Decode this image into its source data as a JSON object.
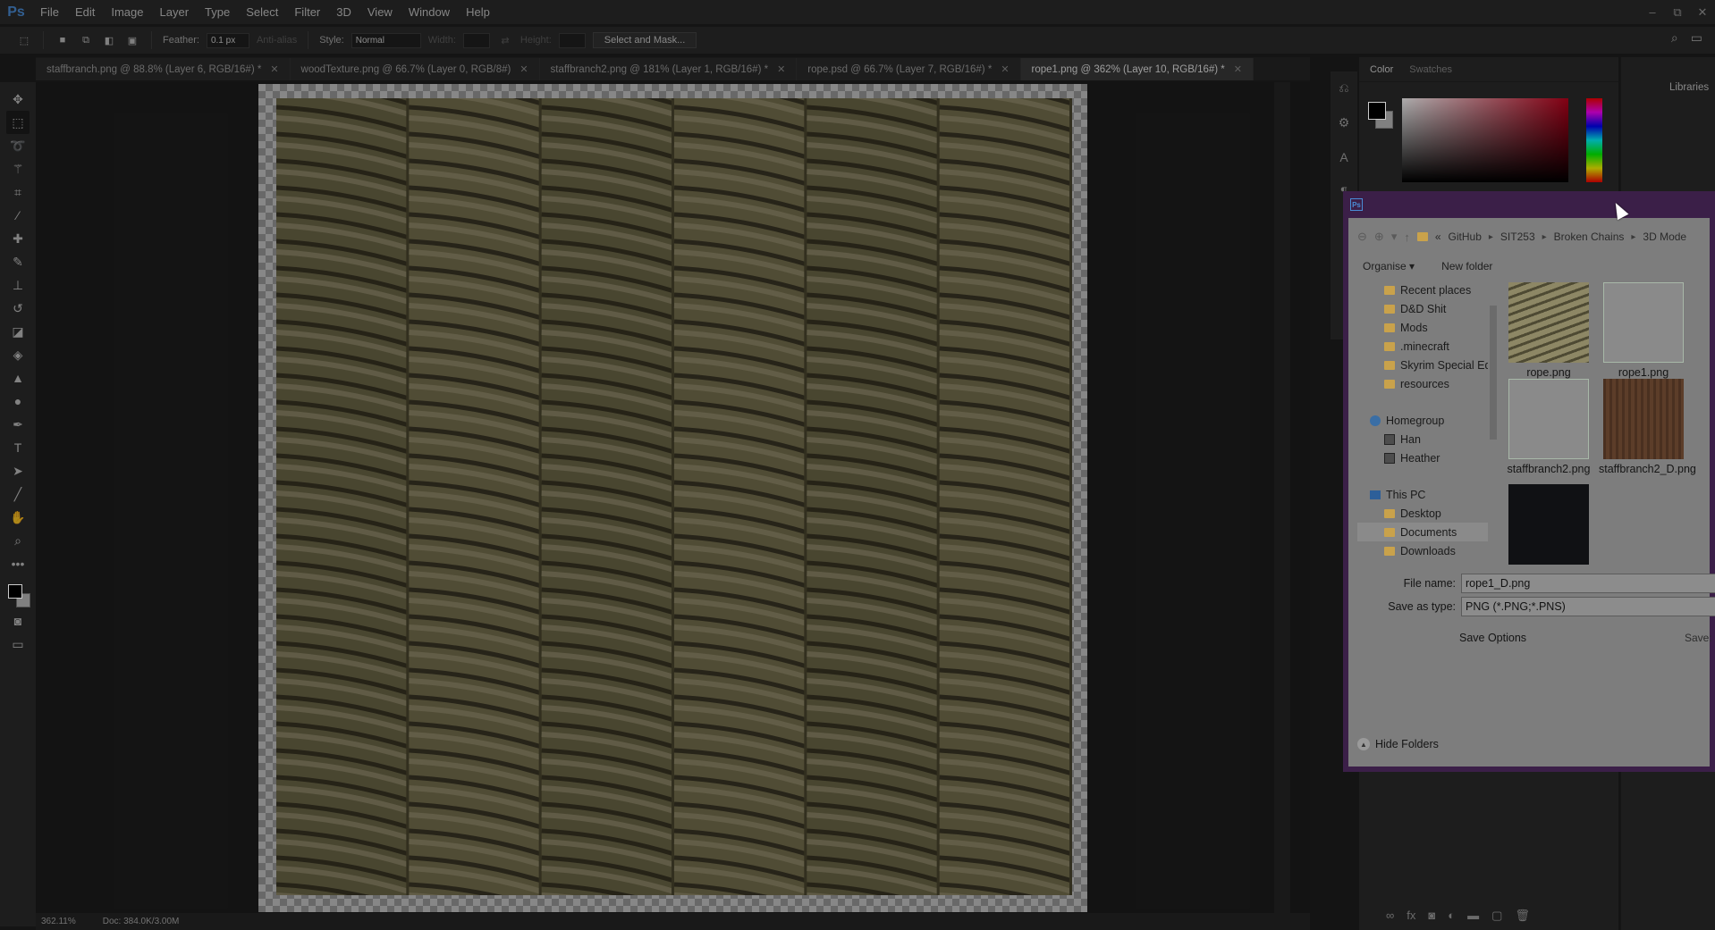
{
  "app": {
    "logo": "Ps"
  },
  "menu": [
    "File",
    "Edit",
    "Image",
    "Layer",
    "Type",
    "Select",
    "Filter",
    "3D",
    "View",
    "Window",
    "Help"
  ],
  "window_controls": {
    "minimize": "–",
    "restore": "⧉",
    "close": "✕"
  },
  "options_bar": {
    "feather_label": "Feather:",
    "feather_value": "0.1 px",
    "anti_alias_label": "Anti-alias",
    "style_label": "Style:",
    "style_value": "Normal",
    "width_label": "Width:",
    "height_label": "Height:",
    "select_mask_label": "Select and Mask..."
  },
  "doc_tabs": [
    {
      "label": "staffbranch.png @ 88.8% (Layer 6, RGB/16#) *",
      "active": false
    },
    {
      "label": "woodTexture.png @ 66.7% (Layer 0, RGB/8#)",
      "active": false
    },
    {
      "label": "staffbranch2.png @ 181% (Layer 1, RGB/16#) *",
      "active": false
    },
    {
      "label": "rope.psd @ 66.7% (Layer 7, RGB/16#) *",
      "active": false
    },
    {
      "label": "rope1.png @ 362% (Layer 10, RGB/16#) *",
      "active": true
    }
  ],
  "status_bar": {
    "zoom": "362.11%",
    "doc_info": "Doc: 384.0K/3.00M"
  },
  "panels": {
    "color_tab": "Color",
    "swatches_tab": "Swatches",
    "libraries_label": "Libraries",
    "foreground_color": "#000000",
    "background_color": "#bdbdbd"
  },
  "save_dialog": {
    "breadcrumb": [
      "GitHub",
      "SIT253",
      "Broken Chains",
      "3D Mode"
    ],
    "breadcrumb_prefix": "«",
    "organise_label": "Organise ▾",
    "new_folder_label": "New folder",
    "nav_favorites": [
      "Recent places",
      "D&D Shit",
      "Mods",
      ".minecraft",
      "Skyrim Special Ed",
      "resources"
    ],
    "nav_homegroup": "Homegroup",
    "nav_homegroup_members": [
      "Han",
      "Heather"
    ],
    "nav_this_pc": "This PC",
    "nav_pc_items": [
      "Desktop",
      "Documents",
      "Downloads"
    ],
    "files": [
      {
        "name": "rope.png",
        "thumb": "rope"
      },
      {
        "name": "rope1.png",
        "thumb": "blank"
      },
      {
        "name": "staffbranch2.png",
        "thumb": "blank"
      },
      {
        "name": "staffbranch2_D.png",
        "thumb": "wood"
      },
      {
        "name": "",
        "thumb": "dark"
      }
    ],
    "file_name_label": "File name:",
    "file_name_value": "rope1_D.png",
    "save_type_label": "Save as type:",
    "save_type_value": "PNG (*.PNG;*.PNS)",
    "save_options_label": "Save Options",
    "save_label": "Save:",
    "hide_folders_label": "Hide Folders"
  }
}
